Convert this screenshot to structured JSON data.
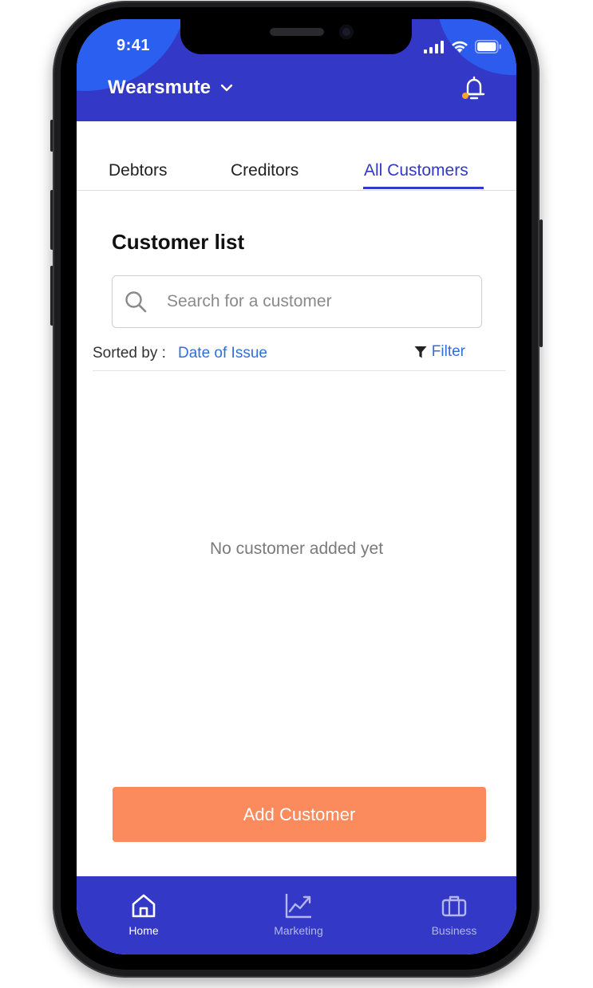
{
  "status_bar": {
    "time": "9:41"
  },
  "header": {
    "brand": "Wearsmute",
    "chevron_icon": "chevron-down-icon",
    "bell_icon": "bell-icon"
  },
  "tabs": [
    {
      "label": "Debtors",
      "active": false
    },
    {
      "label": "Creditors",
      "active": false
    },
    {
      "label": "All Customers",
      "active": true
    }
  ],
  "main": {
    "title": "Customer list",
    "search": {
      "placeholder": "Search for a customer",
      "value": ""
    },
    "sort": {
      "label": "Sorted by :",
      "value": "Date of Issue"
    },
    "filter_label": "Filter",
    "empty_message": "No customer added yet",
    "add_button_label": "Add Customer"
  },
  "bottom_nav": [
    {
      "label": "Home",
      "icon": "home-icon",
      "active": true
    },
    {
      "label": "Marketing",
      "icon": "chart-icon",
      "active": false
    },
    {
      "label": "Business",
      "icon": "briefcase-icon",
      "active": false
    }
  ],
  "colors": {
    "primary": "#3338c6",
    "accent": "#fb8a5c",
    "link": "#2f6fd8",
    "notification_dot": "#f5a623"
  }
}
